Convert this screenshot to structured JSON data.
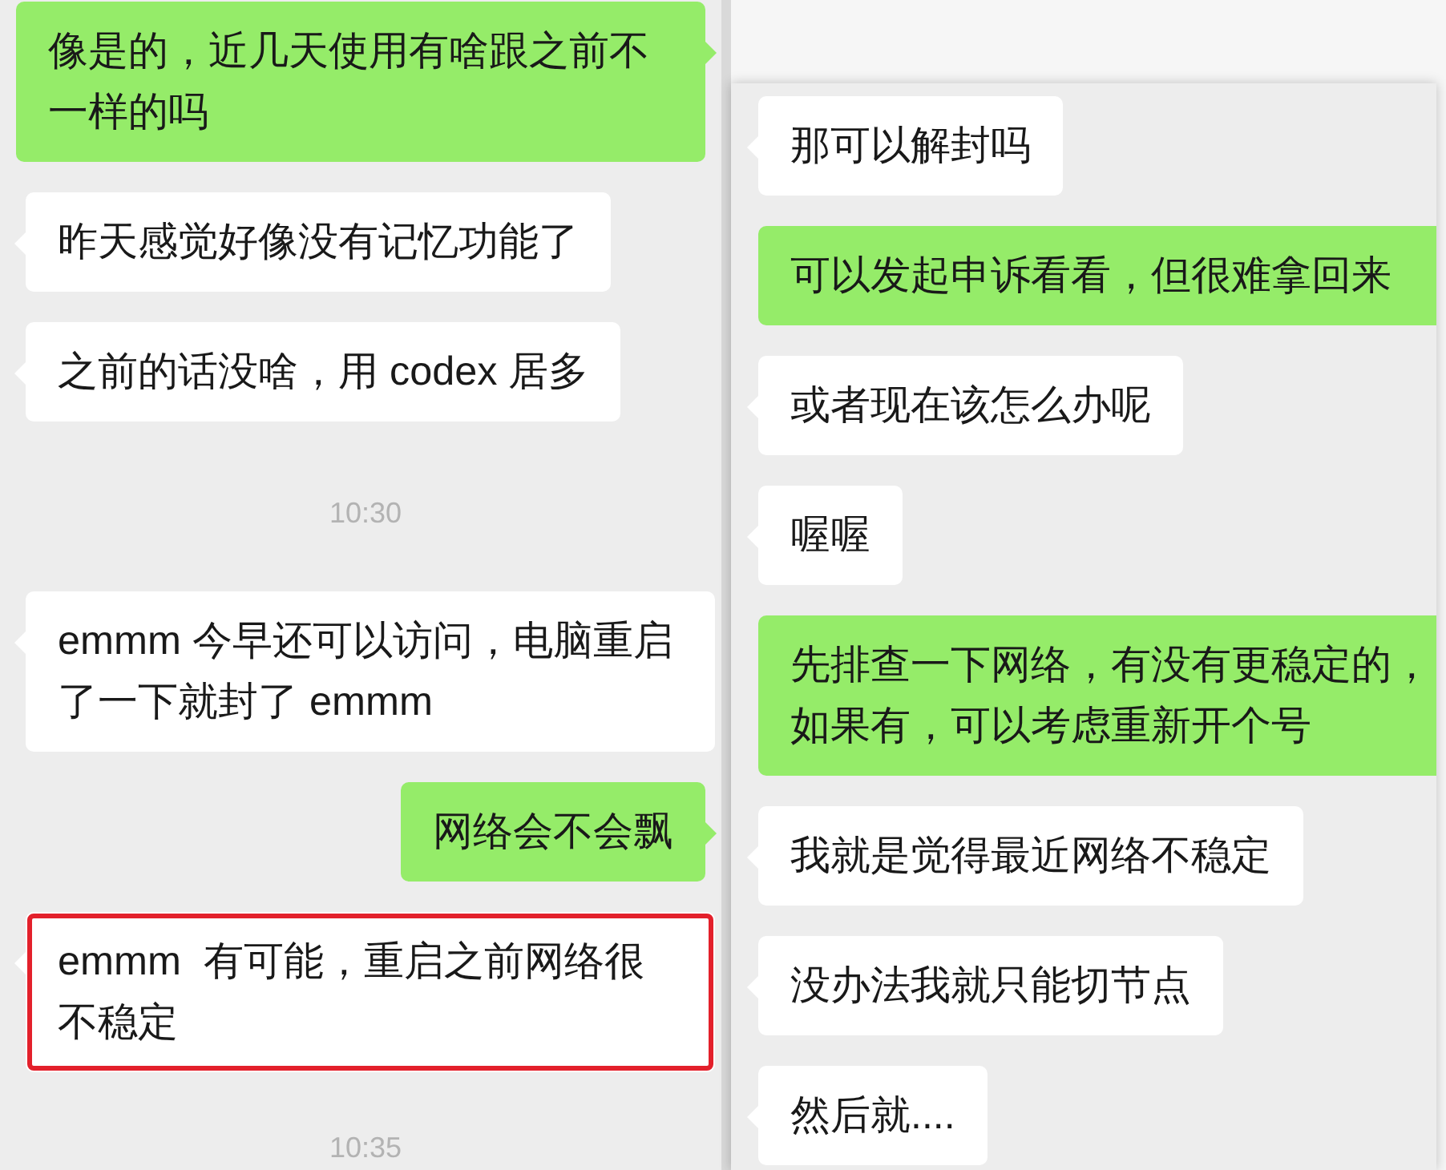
{
  "left_chat": {
    "messages": [
      {
        "kind": "outgoing",
        "text": "像是的，近几天使用有啥跟之前不一样的吗",
        "highlighted": false
      },
      {
        "kind": "incoming",
        "text": "昨天感觉好像没有记忆功能了",
        "highlighted": false
      },
      {
        "kind": "incoming",
        "text": "之前的话没啥，用 codex 居多",
        "highlighted": false
      },
      {
        "kind": "time",
        "text": "10:30",
        "highlighted": false
      },
      {
        "kind": "incoming",
        "text": "emmm 今早还可以访问，电脑重启了一下就封了 emmm",
        "highlighted": false
      },
      {
        "kind": "outgoing",
        "text": "网络会不会飘",
        "highlighted": false
      },
      {
        "kind": "incoming",
        "text": "emmm  有可能，重启之前网络很不稳定",
        "highlighted": true
      },
      {
        "kind": "time",
        "text": "10:35",
        "highlighted": false
      }
    ]
  },
  "right_chat": {
    "messages": [
      {
        "kind": "incoming",
        "text": "那可以解封吗",
        "highlighted": false
      },
      {
        "kind": "outgoing",
        "text": "可以发起申诉看看，但很难拿回来",
        "highlighted": false
      },
      {
        "kind": "incoming",
        "text": "或者现在该怎么办呢",
        "highlighted": false
      },
      {
        "kind": "incoming",
        "text": "喔喔",
        "highlighted": false
      },
      {
        "kind": "outgoing",
        "text": "先排查一下网络，有没有更稳定的，如果有，可以考虑重新开个号",
        "highlighted": false
      },
      {
        "kind": "incoming",
        "text": "我就是觉得最近网络不稳定",
        "highlighted": false
      },
      {
        "kind": "incoming",
        "text": "没办法我就只能切节点",
        "highlighted": false
      },
      {
        "kind": "incoming",
        "text": "然后就....",
        "highlighted": false
      }
    ]
  }
}
